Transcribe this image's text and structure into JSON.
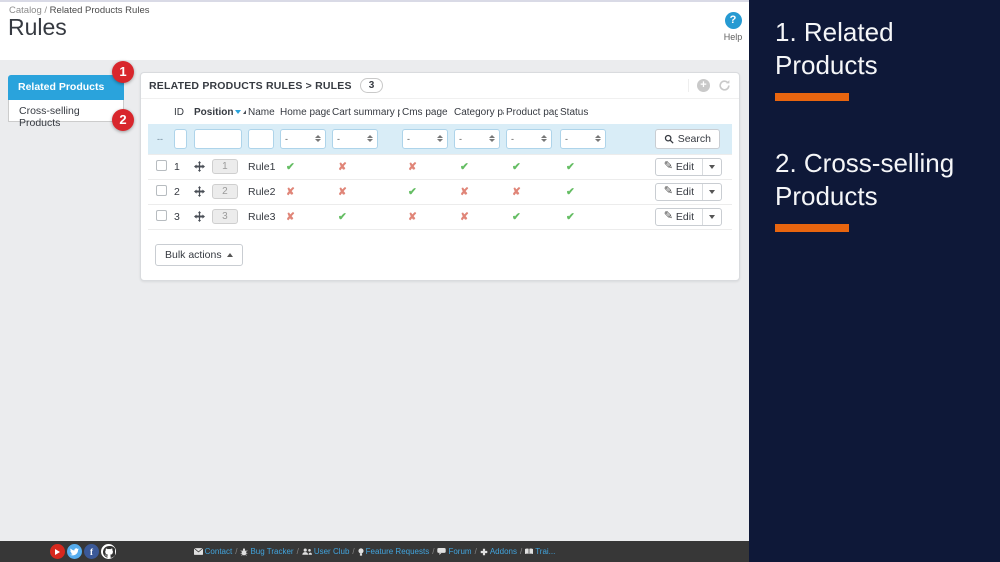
{
  "breadcrumb": {
    "section": "Catalog",
    "separator": "/",
    "current": "Related Products Rules"
  },
  "title": "Rules",
  "help": {
    "icon_glyph": "?",
    "label": "Help"
  },
  "nav_tabs": {
    "items": [
      {
        "label": "Related Products",
        "badge": "1",
        "active": true
      },
      {
        "label": "Cross-selling Products",
        "badge": "2",
        "active": false
      }
    ]
  },
  "panel": {
    "title": "RELATED PRODUCTS RULES > RULES",
    "count": "3",
    "header_icons": [
      "add-icon",
      "refresh-icon"
    ],
    "table": {
      "headers": {
        "id": "ID",
        "position": "Position",
        "name": "Name",
        "home": "Home page",
        "cart": "Cart summary page",
        "cms": "Cms page",
        "category": "Category page",
        "product": "Product page",
        "status": "Status"
      },
      "filter": {
        "checkbox_placeholder": "--",
        "select_value": "-",
        "search_label": "Search"
      },
      "marks": {
        "yes": "✔",
        "no": "✘"
      },
      "rows": [
        {
          "id": "1",
          "position": "1",
          "name": "Rule1",
          "home": true,
          "cart": false,
          "cms": false,
          "category": true,
          "product": true,
          "status": true
        },
        {
          "id": "2",
          "position": "2",
          "name": "Rule2",
          "home": false,
          "cart": false,
          "cms": true,
          "category": false,
          "product": false,
          "status": true
        },
        {
          "id": "3",
          "position": "3",
          "name": "Rule3",
          "home": false,
          "cart": true,
          "cms": false,
          "category": false,
          "product": true,
          "status": true
        }
      ],
      "edit_label": "Edit"
    },
    "bulk_actions_label": "Bulk actions"
  },
  "footer": {
    "social": [
      {
        "name": "youtube-icon"
      },
      {
        "name": "twitter-icon"
      },
      {
        "name": "facebook-icon",
        "glyph": "f"
      },
      {
        "name": "github-icon"
      }
    ],
    "separator": "/",
    "links": [
      {
        "icon": "mail-icon",
        "label": "Contact"
      },
      {
        "icon": "bug-icon",
        "label": "Bug Tracker"
      },
      {
        "icon": "users-icon",
        "label": "User Club"
      },
      {
        "icon": "bulb-icon",
        "label": "Feature Requests"
      },
      {
        "icon": "comment-icon",
        "label": "Forum"
      },
      {
        "icon": "addons-icon",
        "label": "Addons"
      },
      {
        "icon": "book-icon",
        "label": "Trai..."
      }
    ]
  },
  "overlay": {
    "items": [
      {
        "text": "1. Related Products"
      },
      {
        "text": "2. Cross-selling Products"
      }
    ]
  },
  "colors": {
    "accent_blue": "#2aa3dc",
    "badge_red": "#d8262c",
    "check_green": "#64bd63",
    "cross_red": "#e08578",
    "overlay_bg": "#0e1838",
    "overlay_accent": "#e8650f",
    "link_blue": "#41a3dc",
    "filter_row_bg": "#d9edf7",
    "footer_bg": "#373737"
  }
}
